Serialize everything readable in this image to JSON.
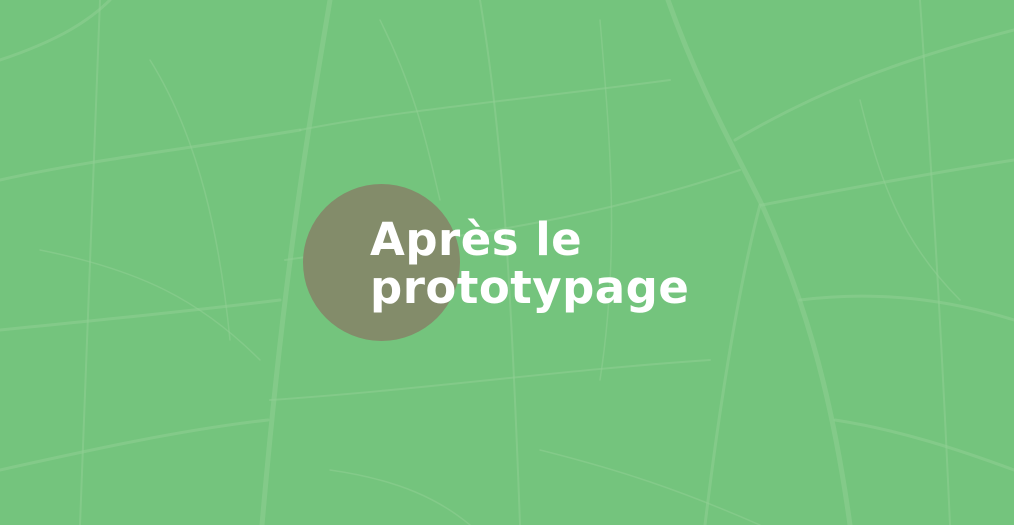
{
  "hero": {
    "title_line1": "Après le",
    "title_line2": "prototypage"
  },
  "colors": {
    "background": "#74c47d",
    "vein": "#8fd094",
    "circle": "#838c6a",
    "title": "#ffffff"
  },
  "icons": {
    "background": "leaf-vein-texture"
  }
}
